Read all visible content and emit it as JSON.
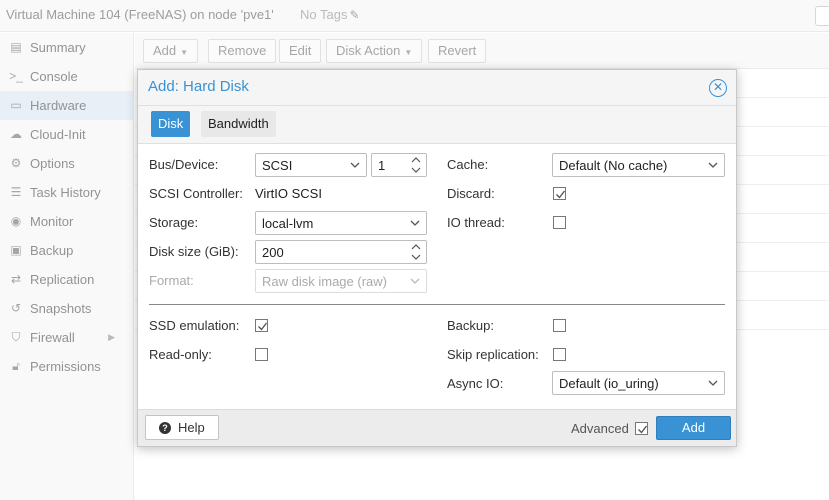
{
  "header": {
    "title": "Virtual Machine 104 (FreeNAS) on node 'pve1'",
    "tags_label": "No Tags"
  },
  "sidebar": {
    "items": [
      {
        "label": "Summary",
        "icon": "document-icon"
      },
      {
        "label": "Console",
        "icon": "terminal-icon"
      },
      {
        "label": "Hardware",
        "icon": "monitor-icon"
      },
      {
        "label": "Cloud-Init",
        "icon": "cloud-icon"
      },
      {
        "label": "Options",
        "icon": "gear-icon"
      },
      {
        "label": "Task History",
        "icon": "list-icon"
      },
      {
        "label": "Monitor",
        "icon": "eye-icon"
      },
      {
        "label": "Backup",
        "icon": "floppy-icon"
      },
      {
        "label": "Replication",
        "icon": "retweet-icon"
      },
      {
        "label": "Snapshots",
        "icon": "history-icon"
      },
      {
        "label": "Firewall",
        "icon": "shield-icon"
      },
      {
        "label": "Permissions",
        "icon": "unlock-icon"
      }
    ]
  },
  "toolbar": {
    "add": "Add",
    "remove": "Remove",
    "edit": "Edit",
    "disk_action": "Disk Action",
    "revert": "Revert"
  },
  "dialog": {
    "title": "Add: Hard Disk",
    "tabs": [
      "Disk",
      "Bandwidth"
    ],
    "fields": {
      "bus_device_label": "Bus/Device:",
      "bus_value": "SCSI",
      "device_index": "1",
      "scsi_controller_label": "SCSI Controller:",
      "scsi_controller_value": "VirtIO SCSI",
      "storage_label": "Storage:",
      "storage_value": "local-lvm",
      "disk_size_label": "Disk size (GiB):",
      "disk_size_value": "200",
      "format_label": "Format:",
      "format_value": "Raw disk image (raw)",
      "cache_label": "Cache:",
      "cache_value": "Default (No cache)",
      "discard_label": "Discard:",
      "discard_checked": true,
      "io_thread_label": "IO thread:",
      "io_thread_checked": false,
      "ssd_emulation_label": "SSD emulation:",
      "ssd_emulation_checked": true,
      "read_only_label": "Read-only:",
      "read_only_checked": false,
      "backup_label": "Backup:",
      "backup_checked": false,
      "skip_replication_label": "Skip replication:",
      "skip_replication_checked": false,
      "async_io_label": "Async IO:",
      "async_io_value": "Default (io_uring)"
    },
    "footer": {
      "help": "Help",
      "advanced_label": "Advanced",
      "advanced_checked": true,
      "add": "Add"
    }
  },
  "colors": {
    "accent": "#3892d4",
    "sidebar_active": "#d7e4f2"
  }
}
